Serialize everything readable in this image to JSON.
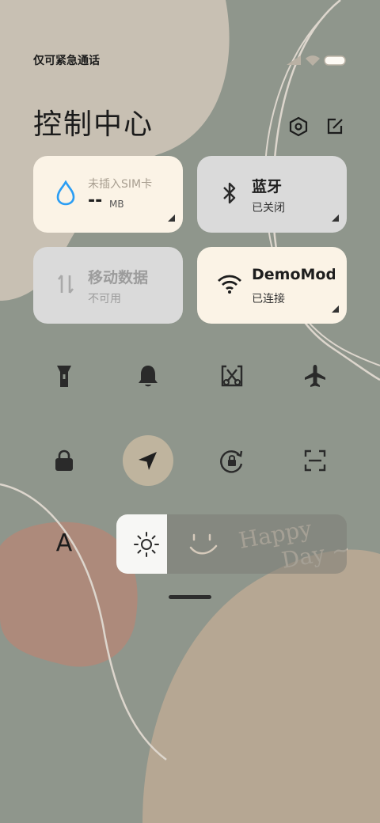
{
  "status_bar": {
    "carrier_text": "仅可紧急通话"
  },
  "header": {
    "title": "控制中心",
    "settings_icon": "settings-hex-icon",
    "edit_icon": "edit-icon"
  },
  "tiles": {
    "data_usage": {
      "title": "未插入SIM卡",
      "value": "--",
      "unit": "MB",
      "icon": "water-drop-icon"
    },
    "bluetooth": {
      "title": "蓝牙",
      "status": "已关闭",
      "icon": "bluetooth-icon"
    },
    "mobile_data": {
      "title": "移动数据",
      "status": "不可用",
      "icon": "mobile-data-icon"
    },
    "wifi": {
      "title": "DemoMode",
      "status": "已连接",
      "icon": "wifi-icon"
    }
  },
  "toggles_row1": [
    "flashlight-icon",
    "bell-icon",
    "screenshot-icon",
    "airplane-icon"
  ],
  "toggles_row2": [
    "lock-icon",
    "location-icon",
    "rotation-lock-icon",
    "scan-icon"
  ],
  "font_button": {
    "label": "A"
  },
  "brightness": {
    "level": 0.22
  },
  "wallpaper_text": {
    "line1": "Happy",
    "line2": "Day ~"
  },
  "colors": {
    "tile_active": "#fbf3e6",
    "tile_inactive": "#dadada",
    "background": "#8f968c",
    "accent_blue": "#2a9df4"
  }
}
